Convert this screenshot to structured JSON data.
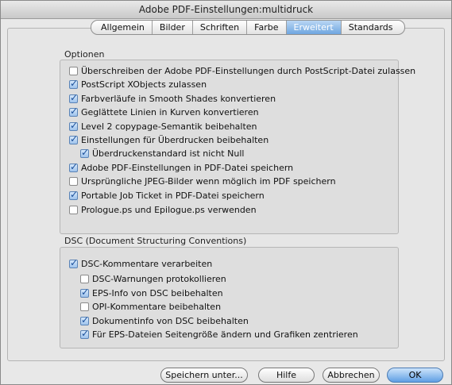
{
  "window": {
    "title": "Adobe PDF-Einstellungen:multidruck"
  },
  "tabs": [
    {
      "label": "Allgemein",
      "active": false
    },
    {
      "label": "Bilder",
      "active": false
    },
    {
      "label": "Schriften",
      "active": false
    },
    {
      "label": "Farbe",
      "active": false
    },
    {
      "label": "Erweitert",
      "active": true
    },
    {
      "label": "Standards",
      "active": false
    }
  ],
  "optionen": {
    "title": "Optionen",
    "items": [
      {
        "label": "Überschreiben der Adobe PDF-Einstellungen durch PostScript-Datei zulassen",
        "checked": false
      },
      {
        "label": "PostScript XObjects zulassen",
        "checked": true
      },
      {
        "label": "Farbverläufe in Smooth Shades konvertieren",
        "checked": true
      },
      {
        "label": "Geglättete Linien in Kurven konvertieren",
        "checked": true
      },
      {
        "label": "Level 2 copypage-Semantik beibehalten",
        "checked": true
      },
      {
        "label": "Einstellungen für Überdrucken beibehalten",
        "checked": true
      },
      {
        "label": "Überdruckenstandard ist nicht Null",
        "checked": true
      },
      {
        "label": "Adobe PDF-Einstellungen in PDF-Datei speichern",
        "checked": true
      },
      {
        "label": "Ursprüngliche JPEG-Bilder wenn möglich im PDF speichern",
        "checked": false
      },
      {
        "label": "Portable Job Ticket in PDF-Datei speichern",
        "checked": true
      },
      {
        "label": "Prologue.ps und Epilogue.ps verwenden",
        "checked": false
      }
    ]
  },
  "dsc": {
    "title": "DSC (Document Structuring Conventions)",
    "items": [
      {
        "label": "DSC-Kommentare verarbeiten",
        "checked": true
      },
      {
        "label": "DSC-Warnungen protokollieren",
        "checked": false
      },
      {
        "label": "EPS-Info von DSC beibehalten",
        "checked": true
      },
      {
        "label": "OPI-Kommentare beibehalten",
        "checked": false
      },
      {
        "label": "Dokumentinfo von DSC beibehalten",
        "checked": true
      },
      {
        "label": "Für EPS-Dateien Seitengröße ändern und Grafiken zentrieren",
        "checked": true
      }
    ]
  },
  "buttons": {
    "save_as": "Speichern unter...",
    "help": "Hilfe",
    "cancel": "Abbrechen",
    "ok": "OK"
  },
  "colors": {
    "accent": "#6fa6e0",
    "checkmark": "#1a4f9a"
  }
}
